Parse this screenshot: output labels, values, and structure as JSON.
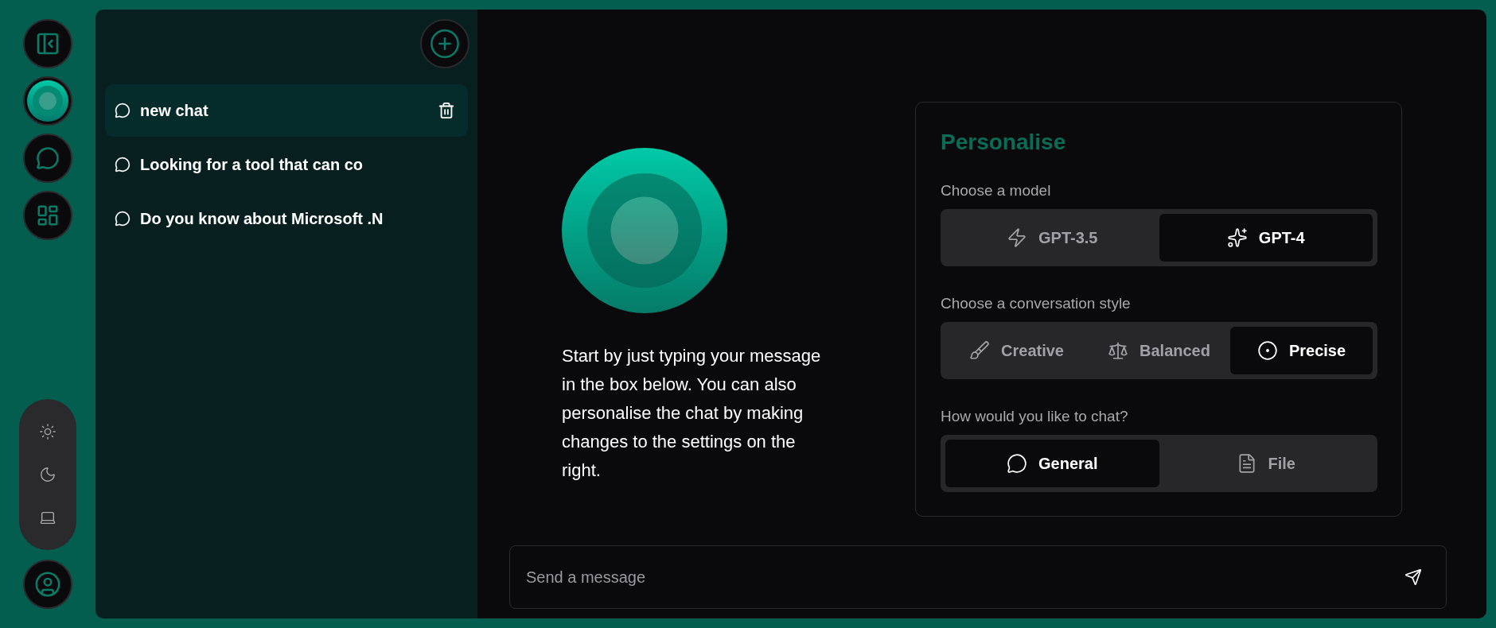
{
  "chats": [
    {
      "title": "new chat",
      "selected": true
    },
    {
      "title": "Looking for a tool that can co",
      "selected": false
    },
    {
      "title": "Do you know about Microsoft .N",
      "selected": false
    }
  ],
  "intro": "Start by just typing your message in the box below. You can also personalise the chat by making changes to the settings on the right.",
  "personalise": {
    "title": "Personalise",
    "groups": [
      {
        "label": "Choose a model",
        "options": [
          {
            "kind": "bolt",
            "label": "GPT-3.5",
            "selected": false
          },
          {
            "kind": "sparkles",
            "label": "GPT-4",
            "selected": true
          }
        ]
      },
      {
        "label": "Choose a conversation style",
        "options": [
          {
            "kind": "brush",
            "label": "Creative",
            "selected": false
          },
          {
            "kind": "scale",
            "label": "Balanced",
            "selected": false
          },
          {
            "kind": "target",
            "label": "Precise",
            "selected": true
          }
        ]
      },
      {
        "label": "How would you like to chat?",
        "options": [
          {
            "kind": "bubble",
            "label": "General",
            "selected": true
          },
          {
            "kind": "file",
            "label": "File",
            "selected": false
          }
        ]
      }
    ]
  },
  "composer": {
    "placeholder": "Send a message"
  }
}
